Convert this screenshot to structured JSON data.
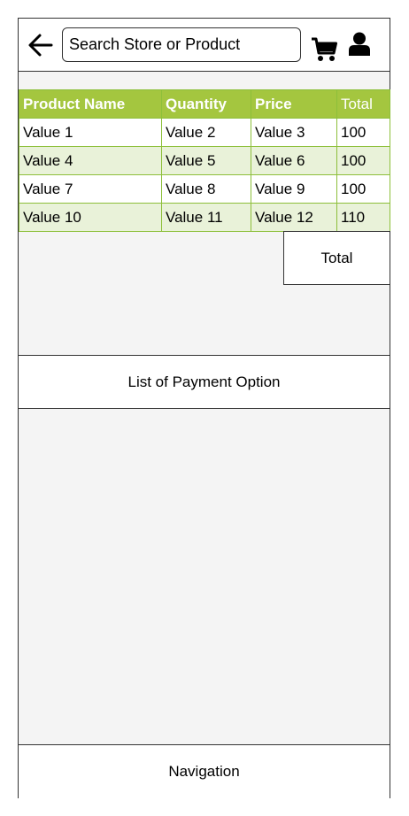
{
  "header": {
    "search_placeholder": "Search Store or Product",
    "icons": [
      "back-arrow-icon",
      "cart-icon",
      "user-icon"
    ]
  },
  "table": {
    "columns": [
      "Product Name",
      "Quantity",
      "Price",
      "Total"
    ],
    "rows": [
      [
        "Value 1",
        "Value 2",
        "Value 3",
        "100"
      ],
      [
        "Value 4",
        "Value 5",
        "Value 6",
        "100"
      ],
      [
        "Value 7",
        "Value 8",
        "Value 9",
        "100"
      ],
      [
        "Value 10",
        "Value 11",
        "Value 12",
        "110"
      ]
    ],
    "header_color": "#a4c63f",
    "alt_row_color": "#e9f2d9"
  },
  "summary": {
    "total_label": "Total"
  },
  "payment": {
    "label": "List of Payment Option"
  },
  "footer": {
    "navigation_label": "Navigation"
  }
}
